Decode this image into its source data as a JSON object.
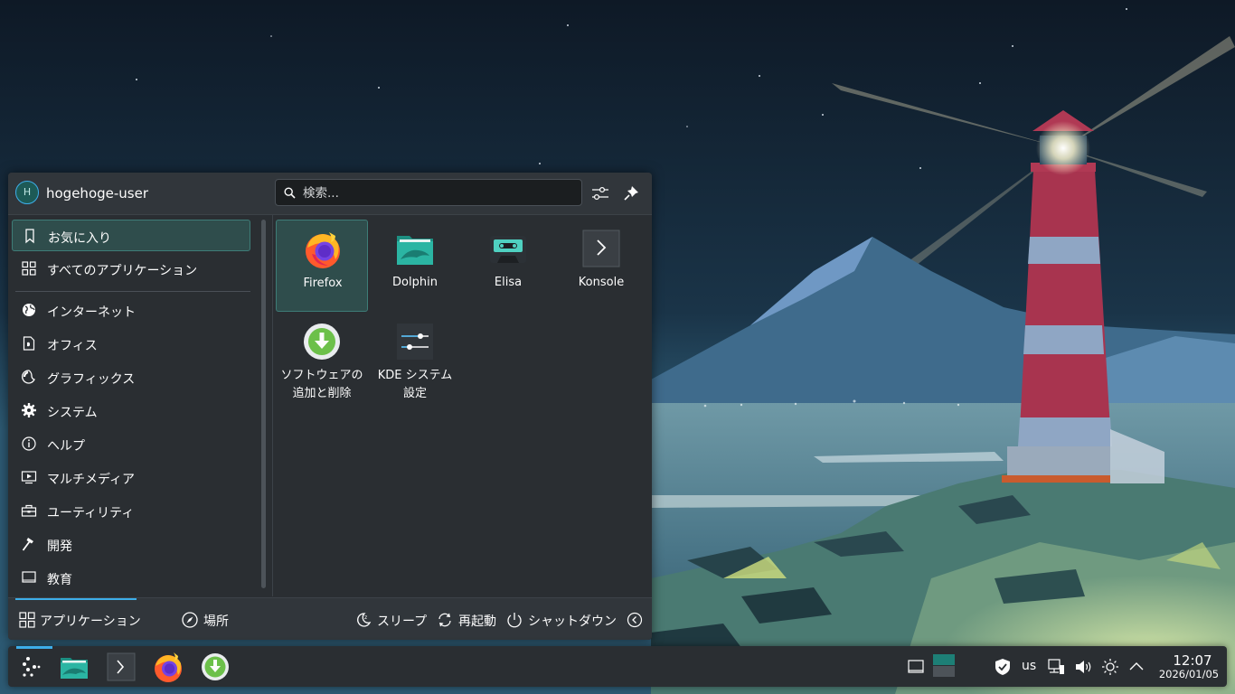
{
  "user": {
    "name": "hogehoge-user",
    "initial": "H"
  },
  "search": {
    "placeholder": "検索..."
  },
  "sidebar": {
    "items": [
      {
        "label": "お気に入り",
        "icon": "bookmark-icon"
      },
      {
        "label": "すべてのアプリケーション",
        "icon": "grid-icon"
      },
      {
        "label": "インターネット",
        "icon": "globe-icon"
      },
      {
        "label": "オフィス",
        "icon": "document-icon"
      },
      {
        "label": "グラフィックス",
        "icon": "palette-icon"
      },
      {
        "label": "システム",
        "icon": "gear-icon"
      },
      {
        "label": "ヘルプ",
        "icon": "info-icon"
      },
      {
        "label": "マルチメディア",
        "icon": "media-icon"
      },
      {
        "label": "ユーティリティ",
        "icon": "toolbox-icon"
      },
      {
        "label": "開発",
        "icon": "hammer-icon"
      },
      {
        "label": "教育",
        "icon": "monitor-icon"
      }
    ]
  },
  "favorites": {
    "apps": [
      {
        "line1": "Firefox",
        "line2": ""
      },
      {
        "line1": "Dolphin",
        "line2": ""
      },
      {
        "line1": "Elisa",
        "line2": ""
      },
      {
        "line1": "Konsole",
        "line2": ""
      },
      {
        "line1": "ソフトウェアの",
        "line2": "追加と削除"
      },
      {
        "line1": "KDE システム",
        "line2": "設定"
      }
    ]
  },
  "footer": {
    "applications": "アプリケーション",
    "places": "場所",
    "sleep": "スリープ",
    "restart": "再起動",
    "shutdown": "シャットダウン"
  },
  "tray": {
    "keyboard_layout": "us"
  },
  "clock": {
    "time": "12:07",
    "date": "2026/01/05"
  },
  "colors": {
    "accent": "#3daee9",
    "panel": "#2a2e32",
    "selection": "#2f4d4c"
  }
}
